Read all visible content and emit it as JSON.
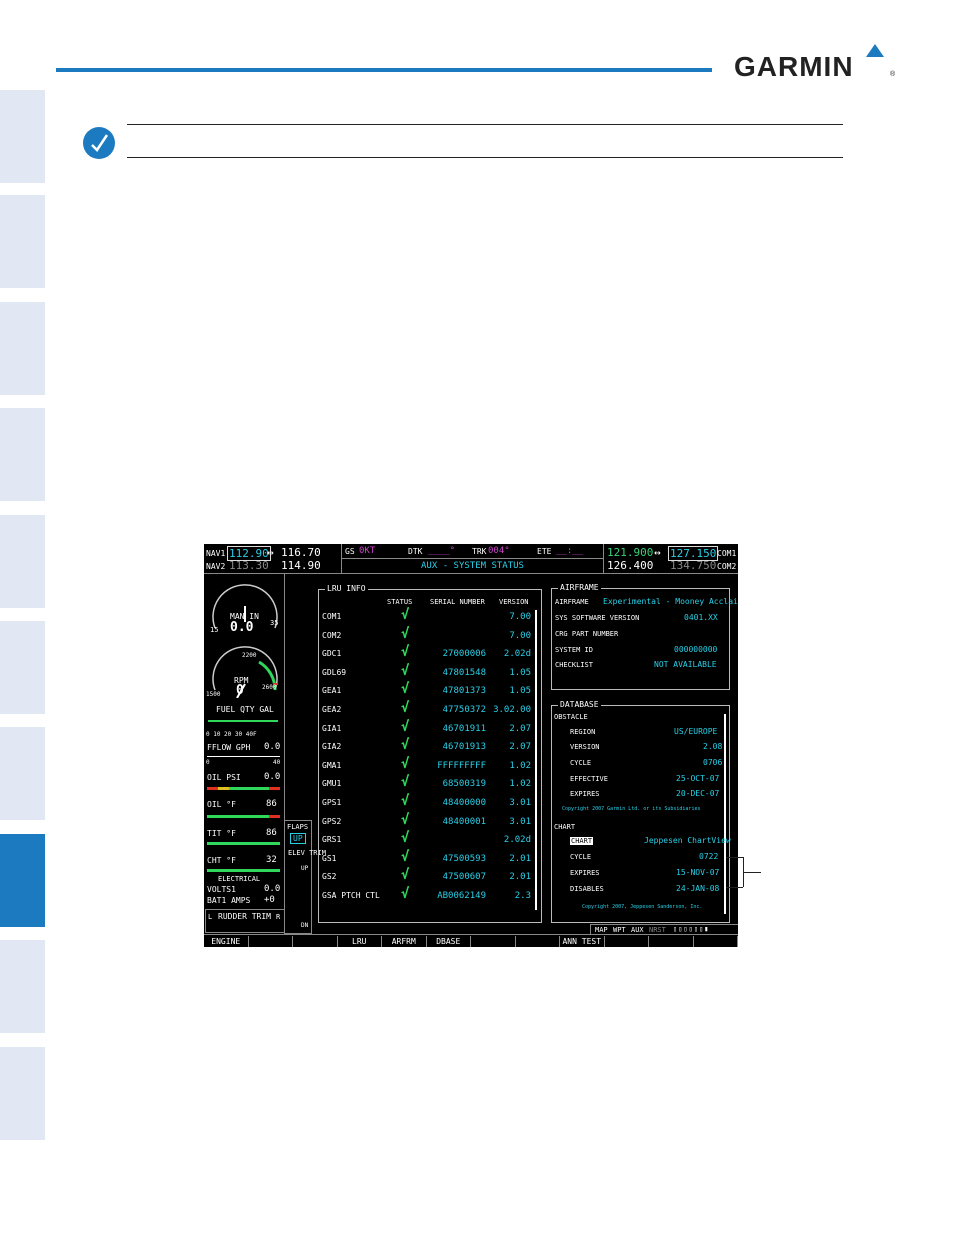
{
  "brand": {
    "name": "GARMIN",
    "accent": "#1c7ac1"
  },
  "screen": {
    "nav1_active": "112.90",
    "nav1_standby": "116.70",
    "nav1_label": "NAV1",
    "nav2_active": "113.30",
    "nav2_standby": "114.90",
    "nav2_label": "NAV2",
    "gs_label": "GS",
    "gs_value": "0KT",
    "dtk_label": "DTK",
    "dtk_value": "____°",
    "trk_label": "TRK",
    "trk_value": "004°",
    "ete_label": "ETE",
    "ete_value": "__:__",
    "page_title": "AUX - SYSTEM STATUS",
    "com1_active": "121.900",
    "com1_standby": "127.150",
    "com1_label": "COM1",
    "com2_active": "126.400",
    "com2_standby": "134.750",
    "com2_label": "COM2",
    "engine": {
      "man_in_label": "MAN IN",
      "man_in_value": "0.0",
      "man_in_min": "15",
      "man_in_max": "35",
      "rpm_label": "RPM",
      "rpm_value": "0",
      "rpm_2200": "2200",
      "rpm_min": "1500",
      "rpm_max": "2600",
      "fuel_label": "FUEL QTY GAL",
      "fuel_scale": "0  10  20  30  40F",
      "fflow_label": "FFLOW GPH",
      "fflow_value": "0.0",
      "fflow_min": "0",
      "fflow_max": "40",
      "oilpsi_label": "OIL PSI",
      "oilpsi_value": "0.0",
      "oilf_label": "OIL °F",
      "oilf_value": "86",
      "tit_label": "TIT °F",
      "tit_value": "86",
      "cht_label": "CHT °F",
      "cht_value": "32",
      "elec_label": "ELECTRICAL",
      "volts_label": "VOLTS1",
      "volts_value": "0.0",
      "amps_label": "BAT1 AMPS",
      "amps_value": "+0",
      "rudder_label": "RUDDER TRIM",
      "rudder_l": "L",
      "rudder_r": "R",
      "flaps_label": "FLAPS",
      "flaps_value": "UP",
      "elev_label": "ELEV TRIM",
      "elev_up": "UP",
      "elev_dn": "DN"
    },
    "lru": {
      "title": "LRU INFO",
      "headers": [
        "STATUS",
        "SERIAL NUMBER",
        "VERSION"
      ],
      "rows": [
        {
          "name": "COM1",
          "serial": "",
          "version": "7.00"
        },
        {
          "name": "COM2",
          "serial": "",
          "version": "7.00"
        },
        {
          "name": "GDC1",
          "serial": "27000006",
          "version": "2.02d"
        },
        {
          "name": "GDL69",
          "serial": "47801548",
          "version": "1.05"
        },
        {
          "name": "GEA1",
          "serial": "47801373",
          "version": "1.05"
        },
        {
          "name": "GEA2",
          "serial": "47750372",
          "version": "3.02.00"
        },
        {
          "name": "GIA1",
          "serial": "46701911",
          "version": "2.07"
        },
        {
          "name": "GIA2",
          "serial": "46701913",
          "version": "2.07"
        },
        {
          "name": "GMA1",
          "serial": "FFFFFFFFF",
          "version": "1.02"
        },
        {
          "name": "GMU1",
          "serial": "68500319",
          "version": "1.02"
        },
        {
          "name": "GPS1",
          "serial": "48400000",
          "version": "3.01"
        },
        {
          "name": "GPS2",
          "serial": "48400001",
          "version": "3.01"
        },
        {
          "name": "GRS1",
          "serial": "",
          "version": "2.02d"
        },
        {
          "name": "GS1",
          "serial": "47500593",
          "version": "2.01"
        },
        {
          "name": "GS2",
          "serial": "47500607",
          "version": "2.01"
        },
        {
          "name": "GSA PTCH CTL",
          "serial": "AB0062149",
          "version": "2.3"
        }
      ]
    },
    "airframe": {
      "title": "AIRFRAME",
      "airframe_label": "AIRFRAME",
      "airframe_value": "Experimental - Mooney Acclaim",
      "sw_label": "SYS SOFTWARE VERSION",
      "sw_value": "0401.XX",
      "crg_label": "CRG PART NUMBER",
      "sysid_label": "SYSTEM ID",
      "sysid_value": "000000000",
      "checklist_label": "CHECKLIST",
      "checklist_value": "NOT AVAILABLE"
    },
    "database": {
      "title": "DATABASE",
      "obstacle_label": "OBSTACLE",
      "region_label": "REGION",
      "region_value": "US/EUROPE",
      "version_label": "VERSION",
      "version_value": "2.08",
      "cycle_label": "CYCLE",
      "cycle_value": "0706",
      "effective_label": "EFFECTIVE",
      "effective_value": "25-OCT-07",
      "expires_label": "EXPIRES",
      "expires_value": "20-DEC-07",
      "obs_copyright": "Copyright 2007 Garmin Ltd. or its Subsidiaries",
      "chart_section": "CHART",
      "chart_label": "CHART",
      "chart_value": "Jeppesen ChartView",
      "chart_cycle_label": "CYCLE",
      "chart_cycle_value": "0722",
      "chart_expires_label": "EXPIRES",
      "chart_expires_value": "15-NOV-07",
      "chart_disables_label": "DISABLES",
      "chart_disables_value": "24-JAN-08",
      "chart_copyright": "Copyright 2007, Jeppesen Sanderson, Inc."
    },
    "page_group": {
      "items": [
        "MAP",
        "WPT",
        "AUX",
        "NRST"
      ]
    },
    "softkeys": [
      "ENGINE",
      "",
      "",
      "LRU",
      "ARFRM",
      "DBASE",
      "",
      "",
      "ANN TEST",
      "",
      "",
      ""
    ]
  }
}
